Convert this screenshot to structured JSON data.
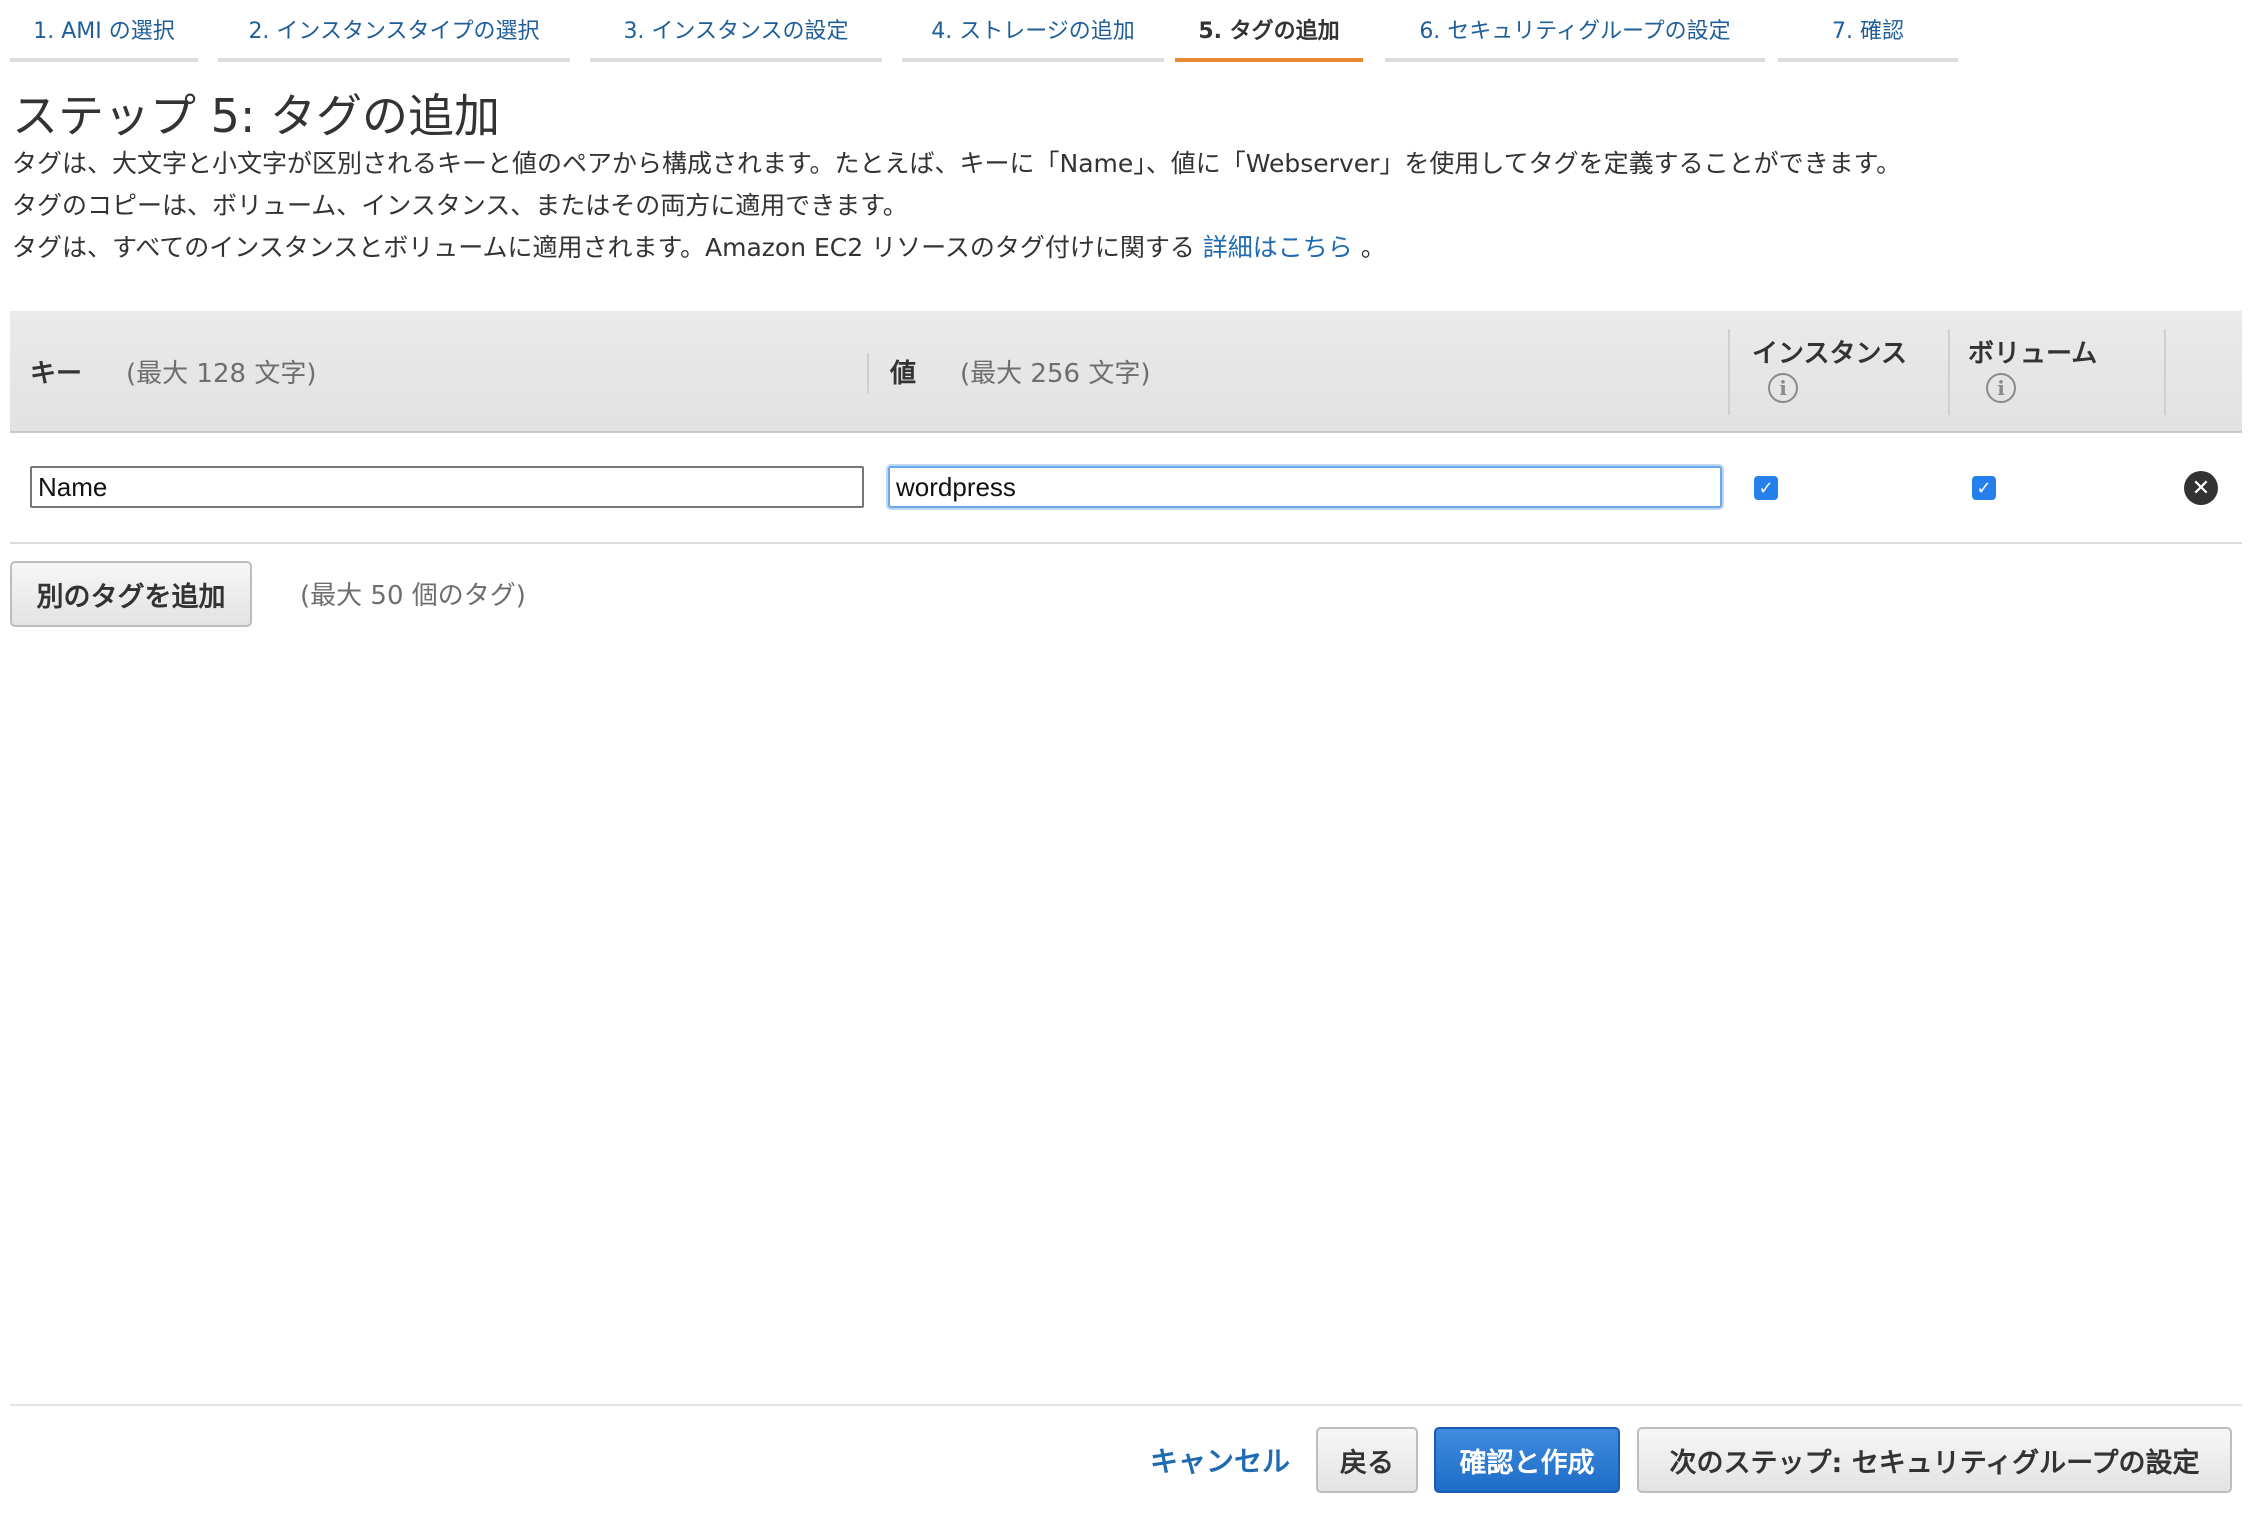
{
  "tabs": [
    {
      "label": "1. AMI の選択"
    },
    {
      "label": "2. インスタンスタイプの選択"
    },
    {
      "label": "3. インスタンスの設定"
    },
    {
      "label": "4. ストレージの追加"
    },
    {
      "label": "5. タグの追加"
    },
    {
      "label": "6. セキュリティグループの設定"
    },
    {
      "label": "7. 確認"
    }
  ],
  "page": {
    "title": "ステップ 5: タグの追加",
    "desc1": "タグは、大文字と小文字が区別されるキーと値のペアから構成されます。たとえば、キーに「Name」、値に「Webserver」を使用してタグを定義することができます。",
    "desc2": "タグのコピーは、ボリューム、インスタンス、またはその両方に適用できます。",
    "desc3": "タグは、すべてのインスタンスとボリュームに適用されます。Amazon EC2 リソースのタグ付けに関する ",
    "desc3_link": "詳細はこちら",
    "desc3_end": " 。"
  },
  "table": {
    "key_header": "キー",
    "key_hint": "(最大 128 文字)",
    "value_header": "値",
    "value_hint": "(最大 256 文字)",
    "instance_header": "インスタンス",
    "volume_header": "ボリューム",
    "info_icon": "i",
    "rows": [
      {
        "key": "Name",
        "value": "wordpress",
        "instance": true,
        "volume": true
      }
    ]
  },
  "add_tag": {
    "button_label": "別のタグを追加",
    "limit_note": "(最大 50 個のタグ)"
  },
  "footer": {
    "cancel": "キャンセル",
    "back": "戻る",
    "review_launch": "確認と作成",
    "next": "次のステップ: セキュリティグループの設定"
  },
  "colors": {
    "active_tab_underline": "#e8882f",
    "link": "#1f6ab3",
    "primary_button": "#1e6cc6"
  }
}
